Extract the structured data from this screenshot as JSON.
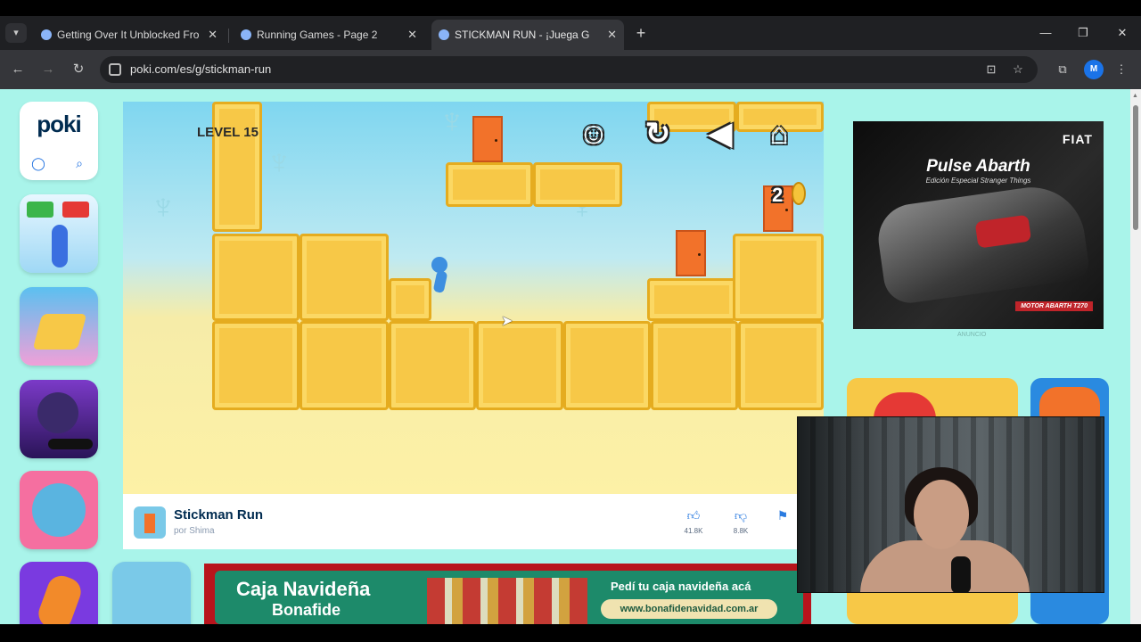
{
  "browser": {
    "tabs": [
      {
        "title": "Getting Over It Unblocked Fro"
      },
      {
        "title": "Running Games - Page 2"
      },
      {
        "title": "STICKMAN RUN - ¡Juega G"
      }
    ],
    "new_tab": "+",
    "url": "poki.com/es/g/stickman-run",
    "profile_initial": "M",
    "window": {
      "minimize": "—",
      "restore": "❐",
      "close": "✕"
    }
  },
  "site": {
    "logo": "poki",
    "user_icon": "user-icon",
    "search_icon": "search-icon"
  },
  "game": {
    "level": "LEVEL 15",
    "coins": "2",
    "title": "Stickman Run",
    "author": "por Shima",
    "likes": "41.8K",
    "dislikes": "8.8K"
  },
  "ad": {
    "brand": "FIAT",
    "title": "Pulse Abarth",
    "subtitle": "Edición Especial Stranger Things",
    "strip": "MOTOR ABARTH T270",
    "label": "ANUNCIO"
  },
  "banner": {
    "title": "Caja Navideña",
    "subtitle": "Bonafide",
    "promo": "Pedí tu caja navideña acá",
    "url": "www.bonafidenavidad.com.ar"
  },
  "colors": {
    "page_bg": "#a9f4ea",
    "block": "#f7c847",
    "door": "#f2722a",
    "stickman": "#3d8fe0",
    "brand_blue": "#002b50"
  }
}
